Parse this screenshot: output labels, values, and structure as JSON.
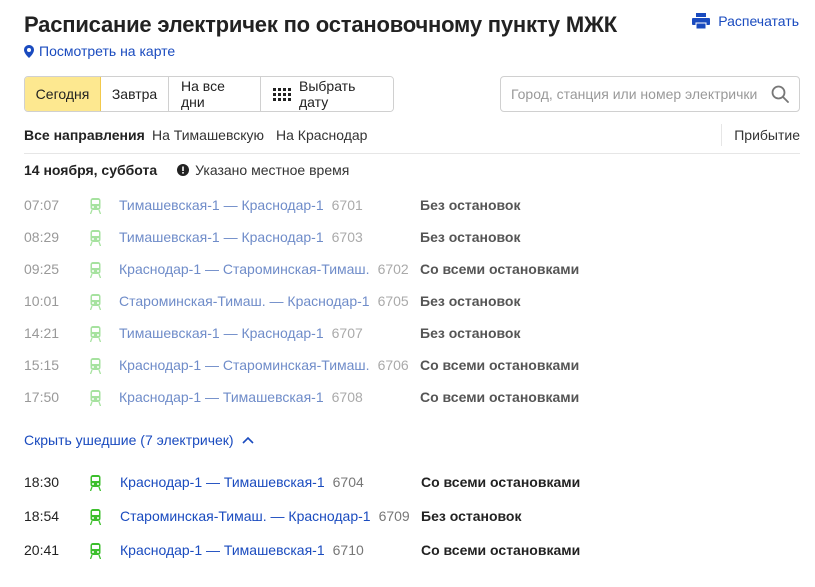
{
  "header": {
    "title": "Расписание электричек по остановочному пункту МЖК",
    "print_label": "Распечатать",
    "map_link": "Посмотреть на карте"
  },
  "day_selector": {
    "today": "Сегодня",
    "tomorrow": "Завтра",
    "all_days": "На все дни",
    "pick_date": "Выбрать дату"
  },
  "search": {
    "placeholder": "Город, станция или номер электрички"
  },
  "tabs": {
    "all": "Все направления",
    "to_timashevskaya": "На Тимашевскую",
    "to_krasnodar": "На Краснодар",
    "arrival": "Прибытие"
  },
  "date_info": {
    "date": "14 ноября, суббота",
    "note": "Указано местное время"
  },
  "past_trains": [
    {
      "time": "07:07",
      "route": "Тимашевская-1 — Краснодар-1",
      "number": "6701",
      "stops": "Без остановок"
    },
    {
      "time": "08:29",
      "route": "Тимашевская-1 — Краснодар-1",
      "number": "6703",
      "stops": "Без остановок"
    },
    {
      "time": "09:25",
      "route": "Краснодар-1 — Староминская-Тимаш.",
      "number": "6702",
      "stops": "Со всеми остановками"
    },
    {
      "time": "10:01",
      "route": "Староминская-Тимаш. — Краснодар-1",
      "number": "6705",
      "stops": "Без остановок"
    },
    {
      "time": "14:21",
      "route": "Тимашевская-1 — Краснодар-1",
      "number": "6707",
      "stops": "Без остановок"
    },
    {
      "time": "15:15",
      "route": "Краснодар-1 — Староминская-Тимаш.",
      "number": "6706",
      "stops": "Со всеми остановками"
    },
    {
      "time": "17:50",
      "route": "Краснодар-1 — Тимашевская-1",
      "number": "6708",
      "stops": "Со всеми остановками"
    }
  ],
  "hide_past_label": "Скрыть ушедшие (7 электричек)",
  "upcoming_trains": [
    {
      "time": "18:30",
      "route": "Краснодар-1 — Тимашевская-1",
      "number": "6704",
      "stops": "Со всеми остановками"
    },
    {
      "time": "18:54",
      "route": "Староминская-Тимаш. — Краснодар-1",
      "number": "6709",
      "stops": "Без остановок"
    },
    {
      "time": "20:41",
      "route": "Краснодар-1 — Тимашевская-1",
      "number": "6710",
      "stops": "Со всеми остановками"
    }
  ],
  "colors": {
    "link": "#1a4bbf",
    "train_icon": "#3cbf2c",
    "active_day": "#fde890"
  }
}
